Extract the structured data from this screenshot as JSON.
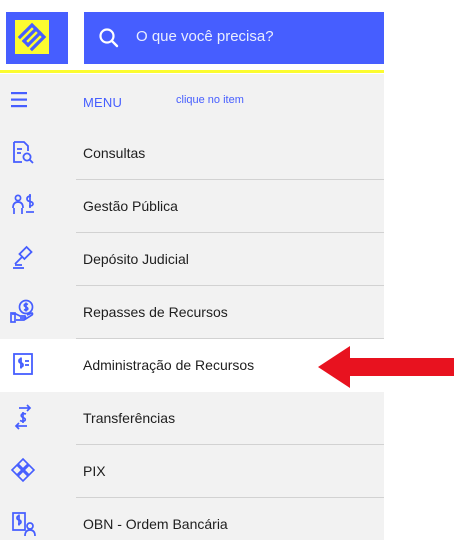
{
  "header": {
    "logo_name": "banco-do-brasil-logo",
    "search": {
      "placeholder": "O que você precisa?"
    }
  },
  "menu": {
    "title": "MENU",
    "hint": "clique no item",
    "items": [
      {
        "label": "Consultas",
        "icon": "document-search-icon"
      },
      {
        "label": "Gestão Pública",
        "icon": "people-money-icon"
      },
      {
        "label": "Depósito Judicial",
        "icon": "gavel-icon"
      },
      {
        "label": "Repasses de Recursos",
        "icon": "hand-coin-icon"
      },
      {
        "label": "Administração de Recursos",
        "icon": "money-document-icon",
        "selected": true
      },
      {
        "label": "Transferências",
        "icon": "transfer-money-icon"
      },
      {
        "label": "PIX",
        "icon": "pix-icon"
      },
      {
        "label": "OBN - Ordem Bancária",
        "icon": "bank-order-icon"
      }
    ]
  },
  "annotation": {
    "color": "#e8121f",
    "direction": "left"
  },
  "colors": {
    "brand_blue": "#465eff",
    "brand_yellow": "#fcfc30"
  }
}
